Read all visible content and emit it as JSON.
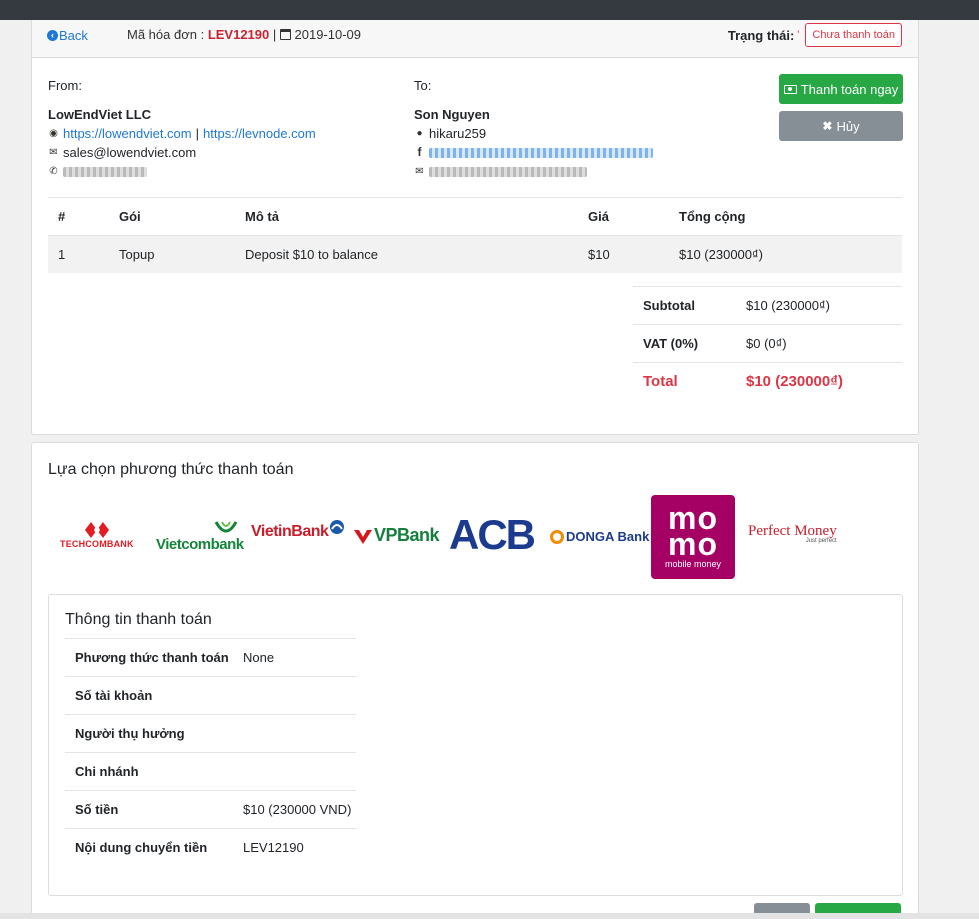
{
  "header": {
    "back_label": "Back",
    "invoice_label": "Mã hóa đơn :",
    "invoice_code": "LEV12190",
    "separator": "|",
    "date": "2019-10-09",
    "status_label": "Trạng thái:",
    "status_value": "Chưa thanh toán"
  },
  "from": {
    "label": "From:",
    "name": "LowEndViet LLC",
    "website1": "https://lowendviet.com",
    "website_sep": "|",
    "website2": "https://levnode.com",
    "email": "sales@lowendviet.com"
  },
  "to": {
    "label": "To:",
    "name": "Son Nguyen",
    "username": "hikaru259"
  },
  "actions": {
    "pay_label": "Thanh toán ngay",
    "cancel_label": "Hủy"
  },
  "items": {
    "headers": [
      "#",
      "Gói",
      "Mô tả",
      "Giá",
      "Tổng cộng"
    ],
    "rows": [
      [
        "1",
        "Topup",
        "Deposit $10 to balance",
        "$10",
        "$10 (230000₫)"
      ]
    ]
  },
  "totals": {
    "subtotal_label": "Subtotal",
    "subtotal_value": "$10 (230000₫)",
    "vat_label": "VAT (0%)",
    "vat_value": "$0 (0₫)",
    "total_label": "Total",
    "total_value": "$10 (230000₫)"
  },
  "payment": {
    "title": "Lựa chọn phương thức thanh toán",
    "methods": [
      "TECHCOMBANK",
      "Vietcombank",
      "VietinBank",
      "VPBank",
      "ACB",
      "DONGA Bank",
      "momo",
      "Perfect Money"
    ],
    "momo_sub": "mobile money",
    "perfect_money_sub": "Just perfect"
  },
  "info": {
    "title": "Thông tin thanh toán",
    "rows": [
      {
        "label": "Phương thức thanh toán",
        "value": "None"
      },
      {
        "label": "Số tài khoản",
        "value": ""
      },
      {
        "label": "Người thụ hưởng",
        "value": ""
      },
      {
        "label": "Chi nhánh",
        "value": ""
      },
      {
        "label": "Số tiền",
        "value": "$10 (230000 VND)"
      },
      {
        "label": "Nội dung chuyển tiền",
        "value": "LEV12190"
      }
    ]
  },
  "colors": {
    "primary": "#1f78d1",
    "danger": "#dc3545",
    "success": "#28a745",
    "secondary": "#868e96",
    "momo": "#a50064"
  }
}
